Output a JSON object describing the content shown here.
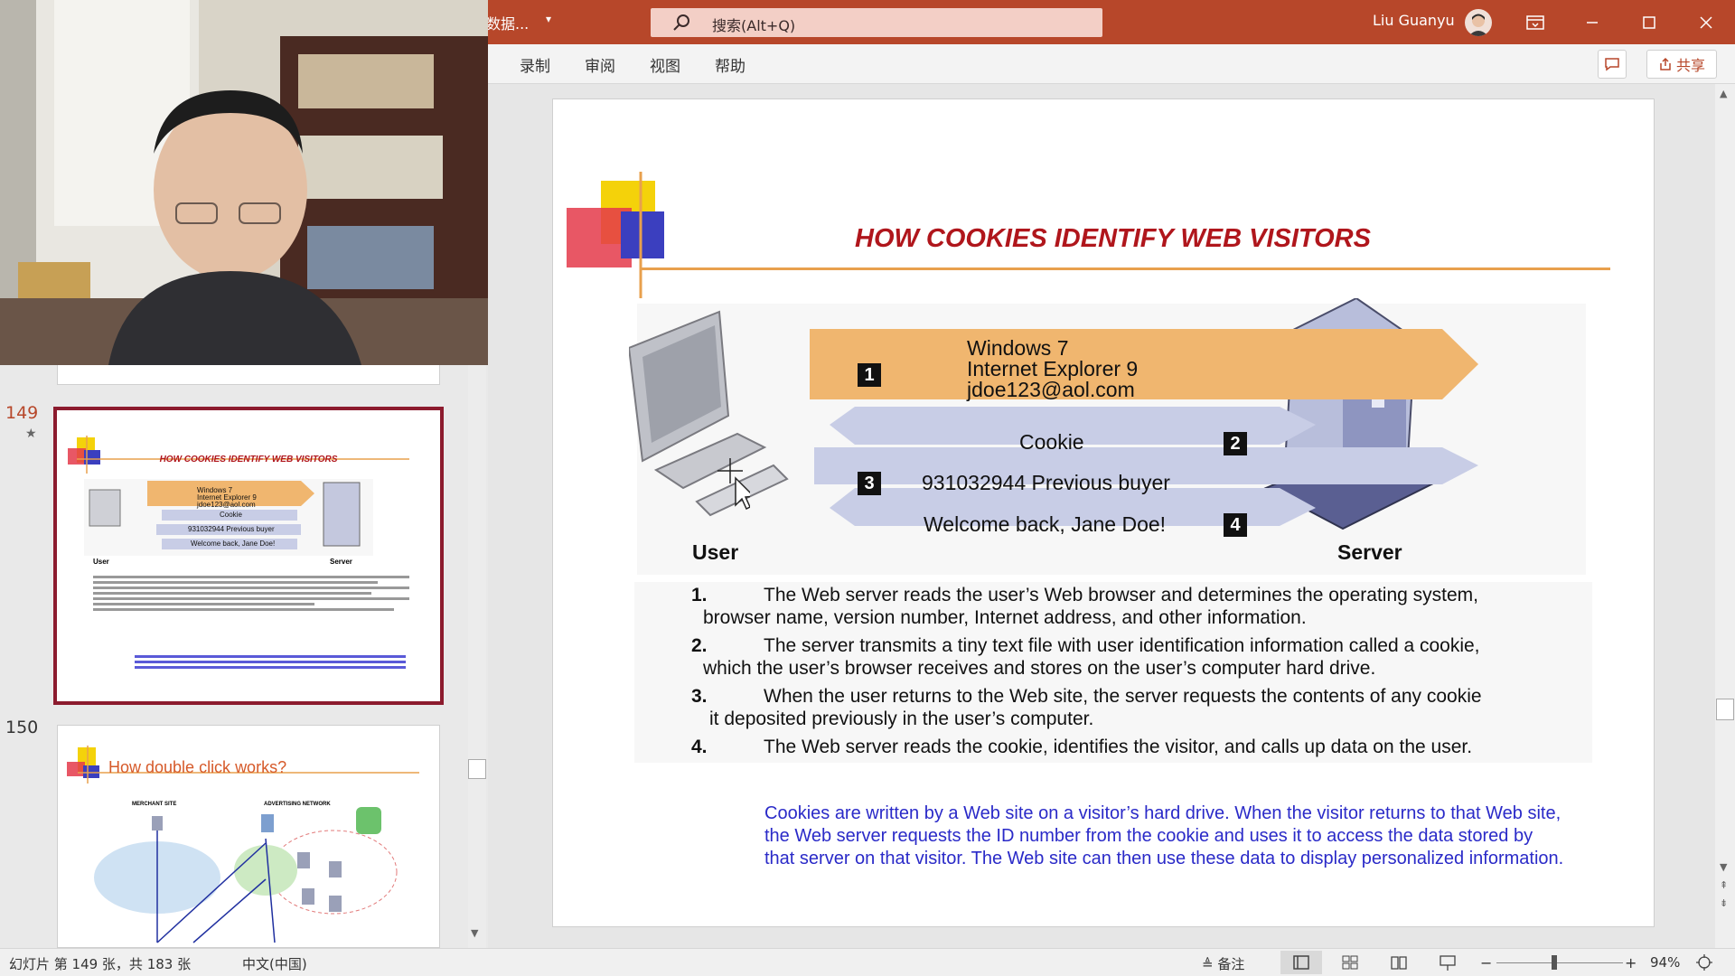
{
  "titlebar": {
    "file_name": "数据...",
    "search_placeholder": "搜索(Alt+Q)",
    "user_name": "Liu Guanyu",
    "colors": {
      "bar": "#b7472a",
      "search": "#f3cfc6"
    }
  },
  "ribbon": {
    "tabs": [
      "录制",
      "审阅",
      "视图",
      "帮助"
    ],
    "share_label": "共享"
  },
  "thumbnails": {
    "slide_149": {
      "number": "149",
      "title": "HOW COOKIES IDENTIFY WEB VISITORS",
      "band1": [
        "Windows 7",
        "Internet Explorer 9",
        "jdoe123@aol.com"
      ],
      "band2": "Cookie",
      "band3": "931032944 Previous buyer",
      "band4": "Welcome back, Jane Doe!",
      "user_label": "User",
      "server_label": "Server"
    },
    "slide_150": {
      "number": "150",
      "title": "How double click works?",
      "merchant_label": "MERCHANT SITE",
      "network_label": "ADVERTISING NETWORK"
    }
  },
  "slide": {
    "title": "HOW COOKIES IDENTIFY WEB VISITORS",
    "user_label": "User",
    "server_label": "Server",
    "bands": [
      {
        "num": "1",
        "lines": [
          "Windows 7",
          "Internet Explorer 9",
          "jdoe123@aol.com"
        ]
      },
      {
        "num": "2",
        "text": "Cookie"
      },
      {
        "num": "3",
        "text": "931032944 Previous buyer"
      },
      {
        "num": "4",
        "text": "Welcome back, Jane Doe!"
      }
    ],
    "steps": [
      {
        "n": "1.",
        "line1": "The Web server reads the user’s Web browser and determines the operating system,",
        "line2": "browser name, version number, Internet address, and other information."
      },
      {
        "n": "2.",
        "line1": "The server transmits a tiny text file with user identification information called a cookie,",
        "line2": "which the user’s browser receives and stores on the user’s computer hard drive."
      },
      {
        "n": "3.",
        "line1": "When the user returns to the Web site, the server requests the contents of any cookie",
        "line2": "it deposited previously in the user’s computer."
      },
      {
        "n": "4.",
        "line1": "The Web server reads the cookie, identifies the visitor, and calls up data on the user.",
        "line2": ""
      }
    ],
    "note_lines": [
      "Cookies are written by a Web site on a visitor’s hard drive. When the visitor returns to that Web site,",
      "the Web server requests the ID number from the cookie and uses it to access the data stored by",
      "that server on that visitor. The Web site can then use these data to display personalized information."
    ],
    "colors": {
      "title": "#b0161c",
      "rule": "#e8a04d",
      "band_orange": "#f0b66f",
      "band_blue": "#c8cde6",
      "note": "#2a2ac8"
    }
  },
  "statusbar": {
    "slide_info": "幻灯片 第 149 张，共 183 张",
    "language": "中文(中国)",
    "notes_label": "备注",
    "zoom": "94%"
  }
}
